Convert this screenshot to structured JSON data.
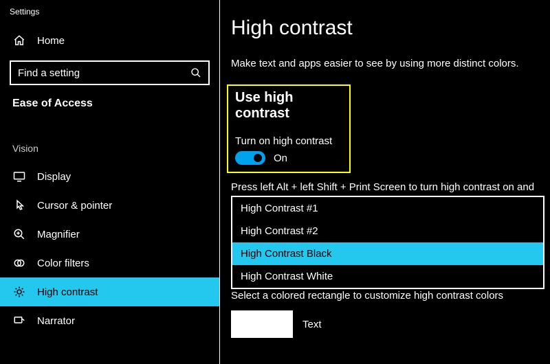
{
  "appTitle": "Settings",
  "homeLabel": "Home",
  "search": {
    "placeholder": "Find a setting"
  },
  "groupHeader": "Ease of Access",
  "visionLabel": "Vision",
  "sidebar": {
    "display": "Display",
    "cursor": "Cursor & pointer",
    "magnifier": "Magnifier",
    "colorfilters": "Color filters",
    "highcontrast": "High contrast",
    "narrator": "Narrator"
  },
  "page": {
    "title": "High contrast",
    "desc": "Make text and apps easier to see by using more distinct colors."
  },
  "hc": {
    "heading": "Use high contrast",
    "toggleLabel": "Turn on high contrast",
    "toggleState": "On"
  },
  "hint": "Press left Alt + left Shift + Print Screen to turn high contrast on and",
  "themes": {
    "opt1": "High Contrast #1",
    "opt2": "High Contrast #2",
    "opt3": "High Contrast Black",
    "opt4": "High Contrast White"
  },
  "covered": "Select a colored rectangle to customize high contrast colors",
  "swatchLabel": "Text",
  "colors": {
    "accent": "#24c7ee",
    "toggle": "#00a2ed",
    "highlight": "#ffff00"
  }
}
